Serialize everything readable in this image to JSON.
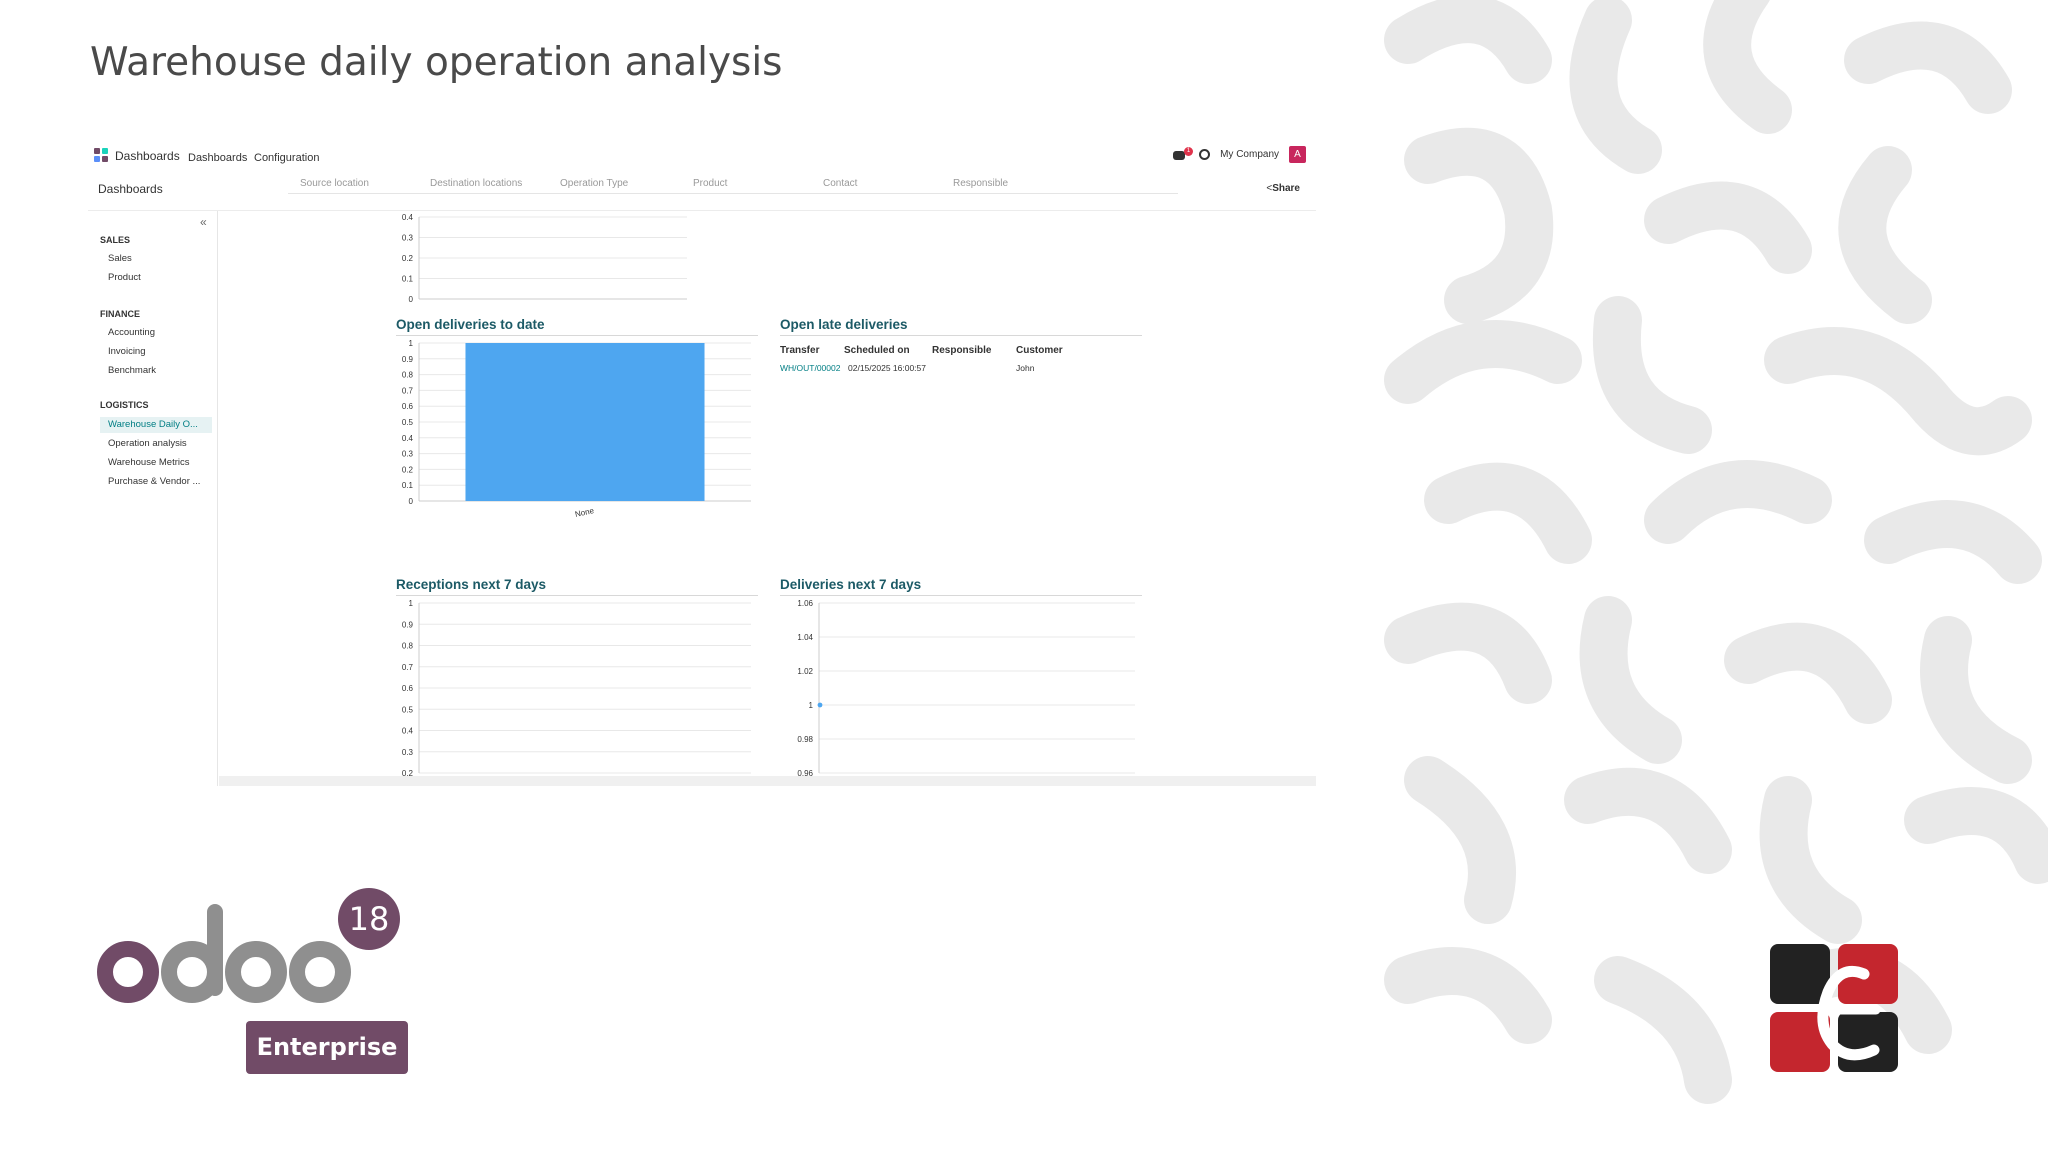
{
  "slide": {
    "title": "Warehouse daily operation analysis"
  },
  "navbar": {
    "app_name": "Dashboards",
    "menu": [
      "Dashboards",
      "Configuration"
    ],
    "chat_badge": "1",
    "company": "My Company",
    "avatar_letter": "A"
  },
  "control": {
    "breadcrumb": "Dashboards",
    "filters": [
      "Source location",
      "Destination locations",
      "Operation Type",
      "Product",
      "Contact",
      "Responsible"
    ],
    "share_label": "Share"
  },
  "sidebar": {
    "collapse_symbol": "«",
    "groups": [
      {
        "heading": "SALES",
        "items": [
          "Sales",
          "Product"
        ]
      },
      {
        "heading": "FINANCE",
        "items": [
          "Accounting",
          "Invoicing",
          "Benchmark"
        ]
      },
      {
        "heading": "LOGISTICS",
        "items": [
          "Warehouse Daily O...",
          "Operation analysis",
          "Warehouse Metrics",
          "Purchase & Vendor ..."
        ]
      }
    ],
    "active_item": "Warehouse Daily O..."
  },
  "cards": {
    "open_deliveries": "Open deliveries to date",
    "open_late": "Open late deliveries",
    "receptions": "Receptions next 7 days",
    "deliveries_next": "Deliveries next 7 days"
  },
  "late_table": {
    "headers": [
      "Transfer",
      "Scheduled on",
      "Responsible",
      "Customer"
    ],
    "rows": [
      {
        "transfer": "WH/OUT/00002",
        "scheduled": "02/15/2025 16:00:57",
        "responsible": "",
        "customer": "John"
      }
    ]
  },
  "chart_data": [
    {
      "type": "bar",
      "title": "",
      "ylim": [
        0,
        0.4
      ],
      "yticks": [
        "0",
        "0.1",
        "0.2",
        "0.3",
        "0.4"
      ],
      "categories": [],
      "values": []
    },
    {
      "type": "bar",
      "title": "Open deliveries to date",
      "categories": [
        "None"
      ],
      "values": [
        1
      ],
      "ylim": [
        0,
        1
      ],
      "yticks": [
        "0",
        "0.1",
        "0.2",
        "0.3",
        "0.4",
        "0.5",
        "0.6",
        "0.7",
        "0.8",
        "0.9",
        "1"
      ],
      "color": "#4ea6f0"
    },
    {
      "type": "line",
      "title": "Receptions next 7 days",
      "ylim": [
        0.2,
        1
      ],
      "yticks": [
        "0.2",
        "0.3",
        "0.4",
        "0.5",
        "0.6",
        "0.7",
        "0.8",
        "0.9",
        "1"
      ],
      "values": []
    },
    {
      "type": "line",
      "title": "Deliveries next 7 days",
      "ylim": [
        0.96,
        1.06
      ],
      "yticks": [
        "0.96",
        "0.98",
        "1",
        "1.02",
        "1.04",
        "1.06"
      ],
      "values": [
        1
      ],
      "color": "#4ea6f0"
    }
  ],
  "branding": {
    "version": "18",
    "edition": "Enterprise",
    "odoo_colors": {
      "first_o": "#714b67",
      "others": "#8f8f8f"
    },
    "partner_colors": {
      "dark": "#222222",
      "red": "#c4262e"
    }
  }
}
